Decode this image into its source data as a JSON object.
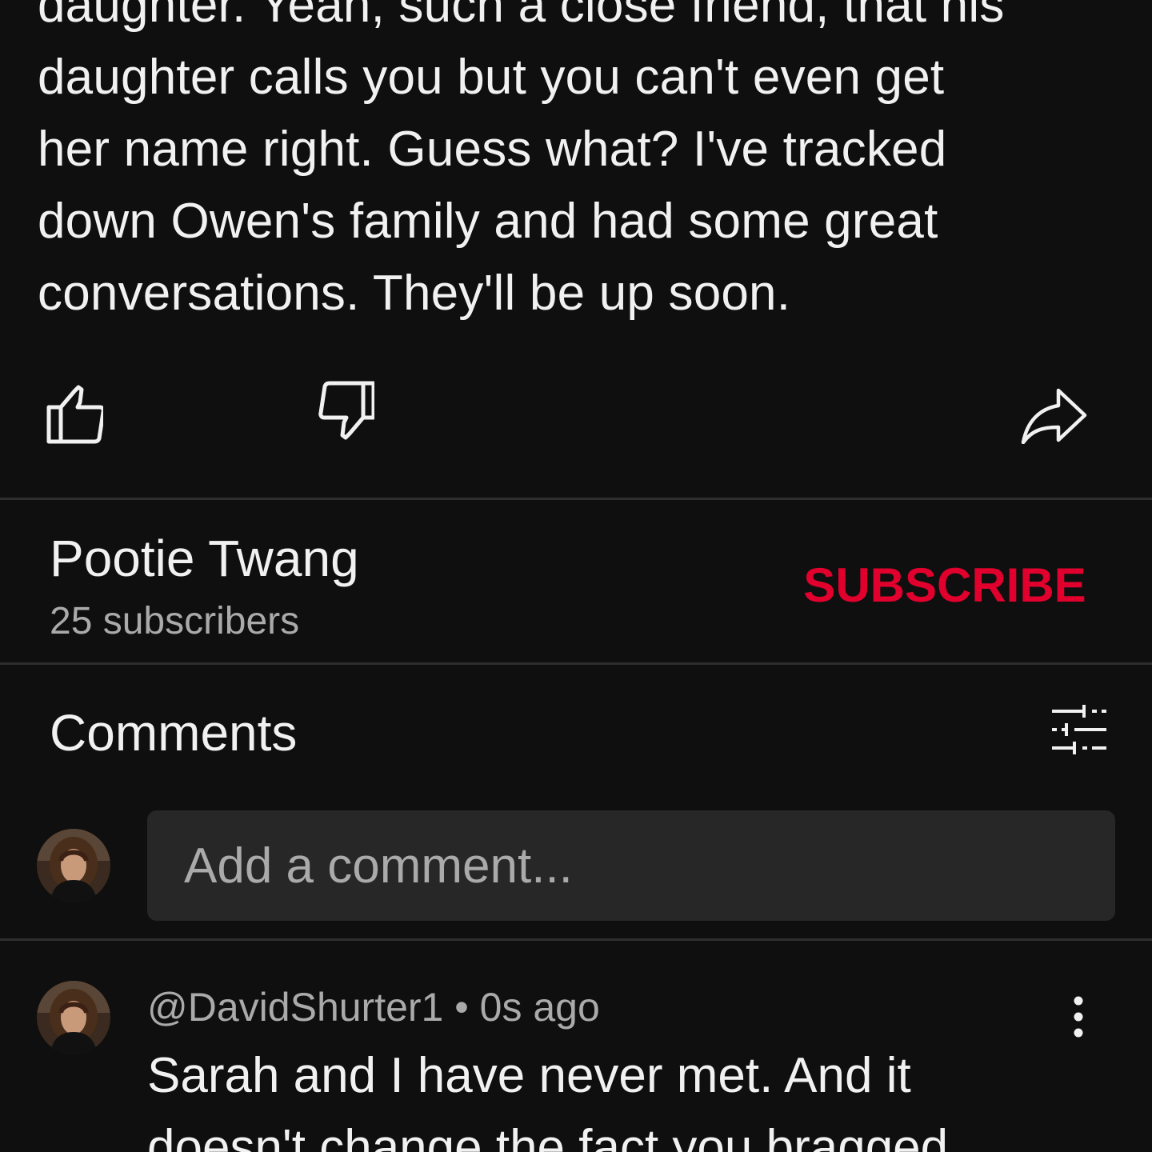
{
  "post": {
    "text_lines": [
      "daughter. Yeah, such a close friend, that his",
      "daughter calls you but you can't even get",
      "her name right. Guess what? I've tracked",
      "down Owen's family and had some great",
      "conversations. They'll be up soon."
    ],
    "actions": {
      "like_icon": "thumbs-up-icon",
      "dislike_icon": "thumbs-down-icon",
      "share_icon": "share-arrow-icon"
    }
  },
  "channel": {
    "name": "Pootie Twang",
    "subscribers": "25 subscribers",
    "subscribe_label": "SUBSCRIBE",
    "subscribe_color": "#e1002d"
  },
  "comments": {
    "title": "Comments",
    "sort_icon": "sliders-icon",
    "add_placeholder": "Add a comment...",
    "items": [
      {
        "author": "@DavidShurter1",
        "separator": " • ",
        "time": "0s ago",
        "text_lines": [
          "Sarah and I have never met. And it",
          "doesn't change the fact you bragged"
        ],
        "more_icon": "more-vertical-icon"
      }
    ]
  }
}
